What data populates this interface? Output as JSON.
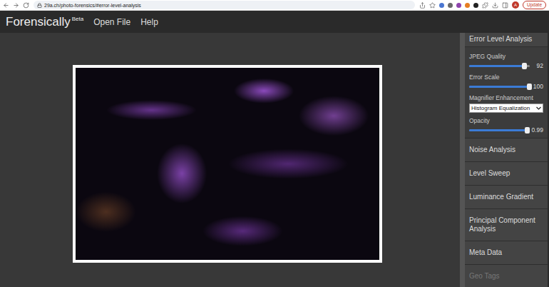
{
  "browser": {
    "url": "29a.ch/photo-forensics/#error-level-analysis",
    "avatar": "A",
    "update_button": "Update"
  },
  "app": {
    "title": "Forensically",
    "badge": "Beta",
    "menu": [
      "Open File",
      "Help"
    ]
  },
  "sidebar": {
    "active_panel": {
      "title": "Error Level Analysis",
      "controls": [
        {
          "kind": "slider",
          "label": "JPEG Quality",
          "value": "92",
          "level": 0.92
        },
        {
          "kind": "slider",
          "label": "Error Scale",
          "value": "100",
          "level": 1.0
        },
        {
          "kind": "select",
          "label": "Magnifier Enhancement",
          "value": "Histogram Equalization"
        },
        {
          "kind": "slider",
          "label": "Opacity",
          "value": "0.99",
          "level": 0.99
        }
      ]
    },
    "sections": [
      {
        "title": "Noise Analysis",
        "disabled": false
      },
      {
        "title": "Level Sweep",
        "disabled": false
      },
      {
        "title": "Luminance Gradient",
        "disabled": false
      },
      {
        "title": "Principal Component Analysis",
        "disabled": false
      },
      {
        "title": "Meta Data",
        "disabled": false
      },
      {
        "title": "Geo Tags",
        "disabled": true
      }
    ]
  }
}
